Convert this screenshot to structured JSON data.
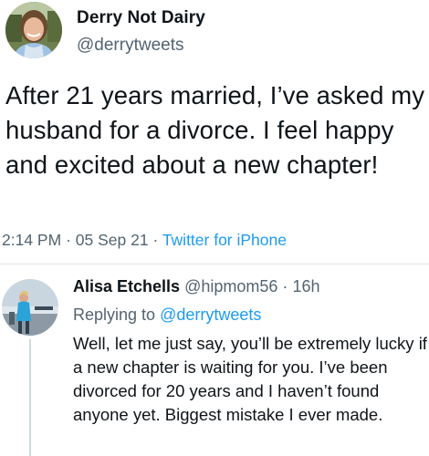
{
  "main_tweet": {
    "display_name": "Derry Not Dairy",
    "handle": "@derrytweets",
    "text": "After 21 years married, I’ve asked my husband for a divorce. I feel happy and excited about a new chapter!",
    "time": "2:14 PM",
    "date": "05 Sep 21",
    "separator": "·",
    "source": "Twitter for iPhone"
  },
  "reply": {
    "display_name": "Alisa Etchells",
    "handle": "@hipmom56",
    "separator": "·",
    "time": "16h",
    "replying_prefix": "Replying to",
    "replying_to": "@derrytweets",
    "text": "Well, let me just say, you’ll be extremely lucky if a new chapter is waiting for you. I’ve been divorced for 20 years and I haven’t found anyone yet. Biggest mistake I ever made."
  },
  "colors": {
    "text": "#0f1419",
    "muted": "#536471",
    "link": "#1d9bf0"
  }
}
